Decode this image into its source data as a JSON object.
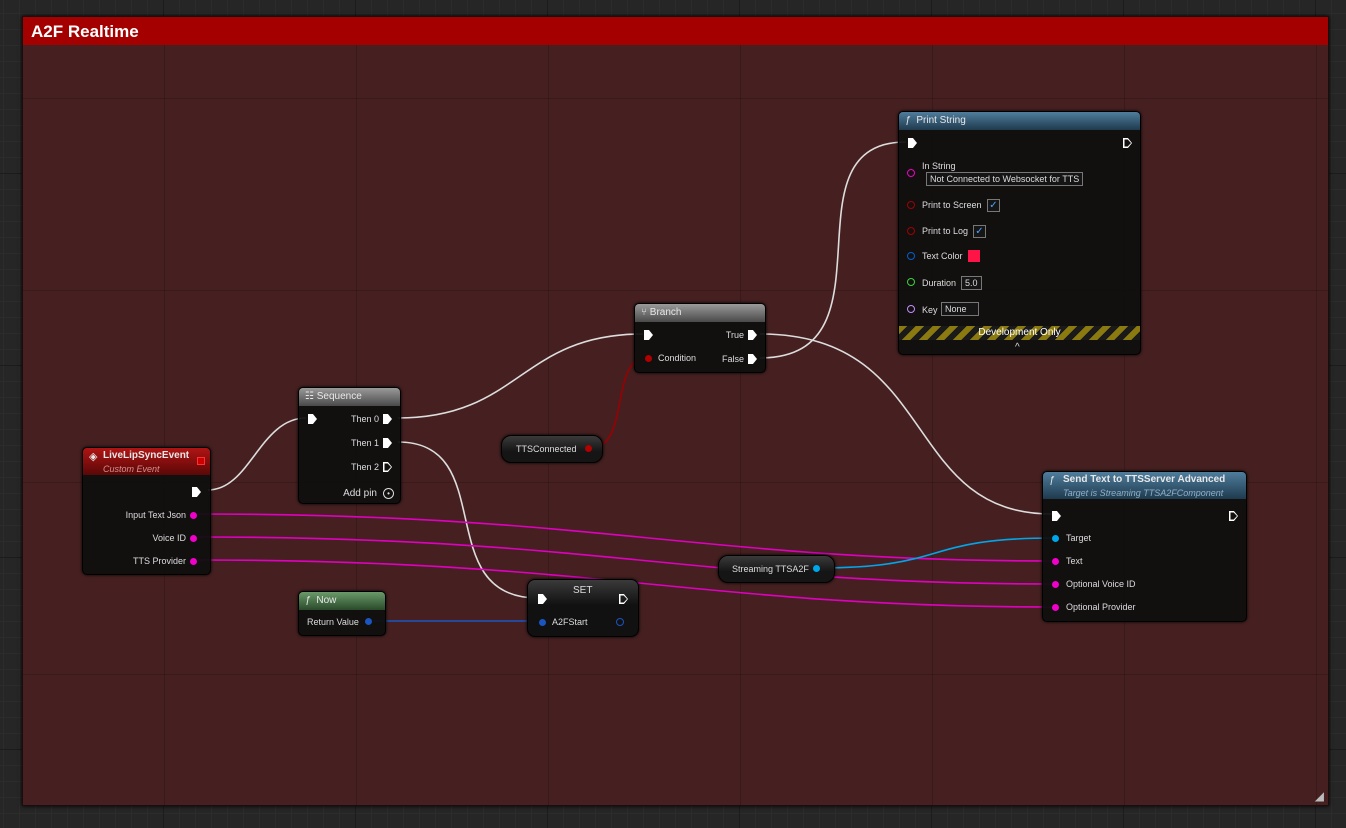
{
  "comment": {
    "title": "A2F Realtime"
  },
  "nodes": {
    "event": {
      "title": "LiveLipSyncEvent",
      "subtitle": "Custom Event",
      "pins": [
        "Input Text Json",
        "Voice ID",
        "TTS Provider"
      ]
    },
    "sequence": {
      "title": "Sequence",
      "then0": "Then 0",
      "then1": "Then 1",
      "then2": "Then 2",
      "add_pin": "Add pin"
    },
    "branch": {
      "title": "Branch",
      "condition": "Condition",
      "true": "True",
      "false": "False"
    },
    "tts_connected": {
      "label": "TTSConnected"
    },
    "print_string": {
      "title": "Print String",
      "in_string_label": "In String",
      "in_string_value": "Not Connected to Websocket for TTS",
      "print_to_screen": "Print to Screen",
      "print_to_log": "Print to Log",
      "text_color": "Text Color",
      "text_color_value": "#ff1447",
      "duration": "Duration",
      "duration_value": "5.0",
      "key": "Key",
      "key_value": "None",
      "dev_only": "Development Only"
    },
    "now": {
      "title": "Now",
      "return_value": "Return Value"
    },
    "set": {
      "title": "SET",
      "pin": "A2FStart"
    },
    "streaming": {
      "label": "Streaming TTSA2F"
    },
    "send_text": {
      "title": "Send Text to TTSServer Advanced",
      "subtitle": "Target is Streaming TTSA2FComponent",
      "target": "Target",
      "text": "Text",
      "voice": "Optional Voice ID",
      "provider": "Optional Provider"
    }
  },
  "icons": {
    "function": "function-icon",
    "event": "event-icon",
    "sequence": "sequence-icon",
    "branch": "branch-icon"
  },
  "colors": {
    "exec": "#ffffff",
    "string": "#f000c8",
    "bool": "#a10000",
    "object": "#00a6ea",
    "struct": "#0060d0",
    "float": "#3bd23b",
    "name": "#c48cff"
  }
}
